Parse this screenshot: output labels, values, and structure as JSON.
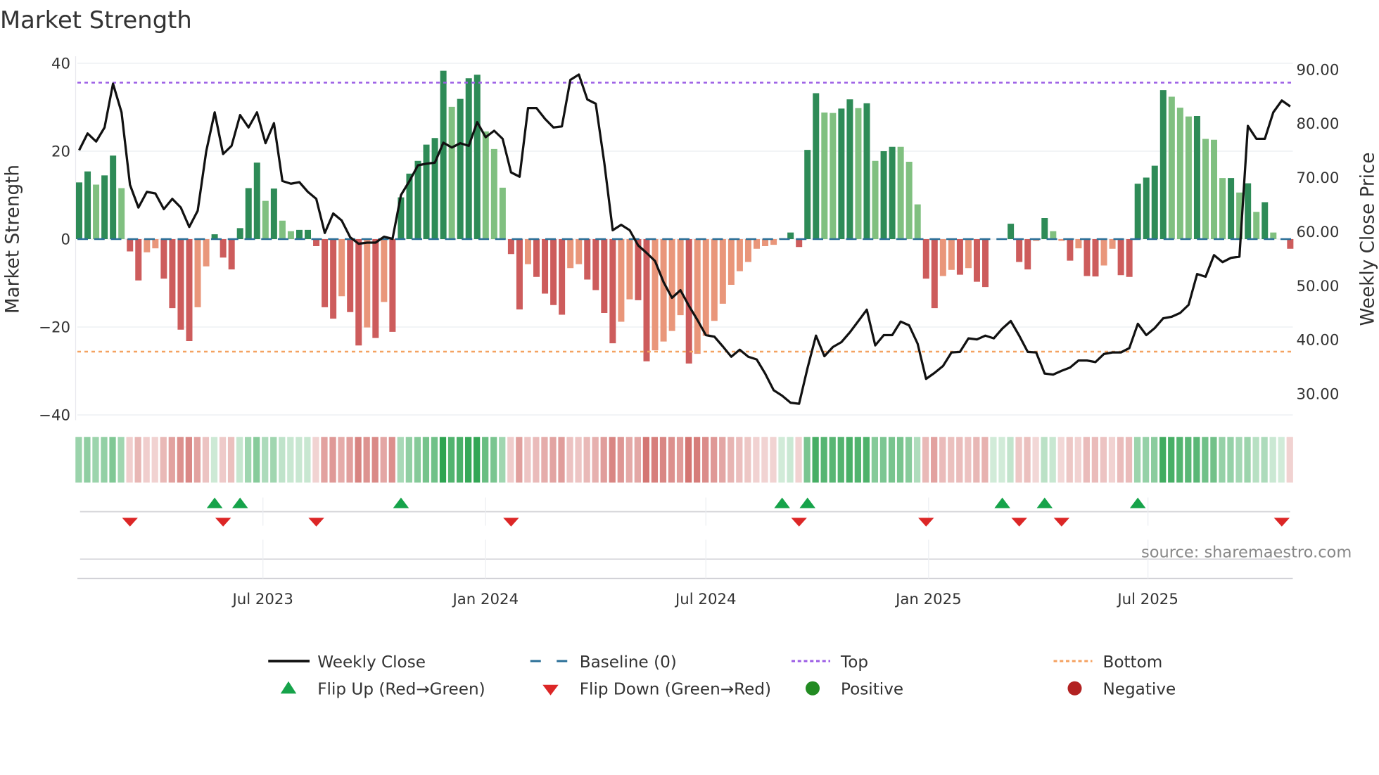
{
  "chart_data": {
    "type": "bar",
    "title": "Market Strength",
    "ylabel": "Market Strength",
    "y2label": "Weekly Close Price",
    "ylim": [
      -42,
      42
    ],
    "y2lim": [
      25,
      92
    ],
    "yticks": [
      40,
      20,
      0,
      -20,
      -40
    ],
    "ytick_labels": [
      "40",
      "20",
      "0",
      "−20",
      "−40"
    ],
    "y2ticks": [
      90,
      80,
      70,
      60,
      50,
      40,
      30
    ],
    "y2tick_labels": [
      "90.00",
      "80.00",
      "70.00",
      "60.00",
      "50.00",
      "40.00",
      "30.00"
    ],
    "x_unit": "week index",
    "xticks": [
      {
        "week": 22.7,
        "label": "Jul 2023"
      },
      {
        "week": 49,
        "label": "Jan 2024"
      },
      {
        "week": 75,
        "label": "Jul 2024"
      },
      {
        "week": 101.3,
        "label": "Jan 2025"
      },
      {
        "week": 127.2,
        "label": "Jul 2025"
      }
    ],
    "strength": [
      12.9,
      15.4,
      12.4,
      14.5,
      19,
      11.6,
      -2.8,
      -9.4,
      -3,
      -2.1,
      -9,
      -15.7,
      -20.6,
      -23.2,
      -15.5,
      -6.2,
      1.1,
      -4.2,
      -6.9,
      2.5,
      11.6,
      17.4,
      8.7,
      11.5,
      4.2,
      1.8,
      2.1,
      2.1,
      -1.6,
      -15.5,
      -18.1,
      -13,
      -16.6,
      -24.2,
      -20.1,
      -22.5,
      -14.3,
      -21.1,
      9.5,
      14.9,
      17.8,
      21.5,
      23,
      38.3,
      30.1,
      31.9,
      36.6,
      37.4,
      24.5,
      20.5,
      11.7,
      -3.4,
      -16,
      -5.7,
      -8.6,
      -12.4,
      -15,
      -17.2,
      -6.6,
      -5.7,
      -9.2,
      -11.6,
      -16.8,
      -23.7,
      -18.8,
      -13.7,
      -13.9,
      -27.8,
      -25.3,
      -23.3,
      -20.9,
      -17.3,
      -28.3,
      -26.1,
      -22,
      -18.6,
      -14.7,
      -10.4,
      -7.3,
      -5.2,
      -2.2,
      -1.6,
      -1.3,
      0.2,
      1.5,
      -1.8,
      20.3,
      33.2,
      28.8,
      28.7,
      29.7,
      31.8,
      29.8,
      30.9,
      17.8,
      20,
      21,
      21,
      17.6,
      7.9,
      -9,
      -15.7,
      -8.4,
      -7,
      -8.1,
      -6.6,
      -9.7,
      -10.9,
      0,
      0,
      3.5,
      -5.2,
      -6.9,
      -0.4,
      4.8,
      1.8,
      -0.4,
      -4.9,
      -2.1,
      -8.4,
      -8.5,
      -6,
      -2.2,
      -8.2,
      -8.6,
      12.6,
      14,
      16.7,
      33.9,
      32.4,
      29.9,
      27.9,
      28,
      22.8,
      22.6,
      13.9,
      13.9,
      10.6,
      12.7,
      6.2,
      8.4,
      1.5,
      0,
      -2.2
    ],
    "strong": [
      1,
      1,
      0,
      1,
      1,
      0,
      1,
      1,
      0,
      0,
      1,
      1,
      1,
      1,
      0,
      0,
      1,
      1,
      1,
      1,
      1,
      1,
      0,
      1,
      0,
      0,
      1,
      1,
      1,
      1,
      1,
      0,
      1,
      1,
      0,
      1,
      0,
      1,
      1,
      1,
      1,
      1,
      1,
      1,
      0,
      1,
      1,
      1,
      0,
      0,
      0,
      1,
      1,
      0,
      1,
      1,
      1,
      1,
      0,
      0,
      1,
      1,
      1,
      1,
      0,
      0,
      1,
      1,
      0,
      0,
      0,
      0,
      1,
      0,
      0,
      0,
      0,
      0,
      0,
      0,
      0,
      0,
      0,
      0,
      1,
      1,
      1,
      1,
      0,
      0,
      1,
      1,
      0,
      1,
      0,
      1,
      1,
      0,
      0,
      0,
      1,
      1,
      0,
      0,
      1,
      0,
      1,
      1,
      0,
      0,
      1,
      1,
      1,
      0,
      1,
      0,
      0,
      1,
      0,
      1,
      1,
      0,
      0,
      1,
      1,
      1,
      1,
      1,
      1,
      0,
      0,
      0,
      1,
      0,
      0,
      0,
      1,
      0,
      1,
      0,
      1,
      0,
      0,
      1
    ],
    "weekly_close": [
      74.9,
      78,
      76.5,
      79.1,
      87.2,
      81.9,
      68.5,
      64.3,
      67.2,
      66.9,
      64,
      65.9,
      64.3,
      60.7,
      63.7,
      74.7,
      81.9,
      74.2,
      75.7,
      81.4,
      79.1,
      81.9,
      76.2,
      79.9,
      69.2,
      68.7,
      69,
      67.2,
      65.9,
      59.6,
      63.2,
      61.9,
      58.8,
      57.6,
      57.8,
      57.8,
      58.9,
      58.5,
      66.6,
      69.2,
      72.1,
      72.4,
      72.6,
      76.3,
      75.4,
      76.2,
      75.7,
      80.1,
      77.3,
      78.5,
      77,
      70.8,
      70,
      82.7,
      82.7,
      80.7,
      79.1,
      79.3,
      87.9,
      88.9,
      84.3,
      83.5,
      72.6,
      60.1,
      61.1,
      60.1,
      57.3,
      55.9,
      54.4,
      50.5,
      47.6,
      49,
      46.1,
      43.5,
      40.7,
      40.4,
      38.6,
      36.7,
      38,
      36.7,
      36.2,
      33.6,
      30.5,
      29.5,
      28.2,
      28,
      34.6,
      40.6,
      36.8,
      38.5,
      39.4,
      41.2,
      43.3,
      45.4,
      38.8,
      40.7,
      40.7,
      43.2,
      42.5,
      39.1,
      32.6,
      33.7,
      35,
      37.5,
      37.6,
      40.1,
      39.9,
      40.6,
      40.1,
      41.9,
      43.3,
      40.6,
      37.6,
      37.5,
      33.6,
      33.4,
      34.1,
      34.7,
      36,
      36,
      35.7,
      37.2,
      37.5,
      37.5,
      38.3,
      42.8,
      40.7,
      42,
      43.8,
      44.1,
      44.8,
      46.3,
      52,
      51.5,
      55.5,
      54.2,
      55,
      55.2,
      79.4,
      77,
      77,
      81.9,
      84.1,
      83
    ],
    "top_level": 35.6,
    "bottom_level": -25.6,
    "baseline": 0,
    "flip_up_weeks": [
      17,
      20,
      39,
      84,
      87,
      110,
      115,
      126
    ],
    "flip_down_weeks": [
      7,
      18,
      29,
      52,
      86,
      101,
      112,
      117,
      143
    ],
    "legend_position": "bottom",
    "legend": [
      {
        "label": "Weekly Close",
        "kind": "line-solid",
        "color": "#111111"
      },
      {
        "label": "Baseline (0)",
        "kind": "line-dashed",
        "color": "#2a6f97"
      },
      {
        "label": "Top",
        "kind": "line-dotted",
        "color": "#9b5de5"
      },
      {
        "label": "Bottom",
        "kind": "line-dotted",
        "color": "#f4a261"
      },
      {
        "label": "Flip Up (Red→Green)",
        "kind": "triangle-up",
        "color": "#16a34a"
      },
      {
        "label": "Flip Down (Green→Red)",
        "kind": "triangle-down",
        "color": "#dc2626"
      },
      {
        "label": "Positive",
        "kind": "dot",
        "color": "#228b22"
      },
      {
        "label": "Negative",
        "kind": "dot",
        "color": "#b22222"
      }
    ],
    "colors": {
      "strong_pos": "#2e8b57",
      "weak_pos": "#80c080",
      "strong_neg": "#cd5c5c",
      "weak_neg": "#e9967a",
      "strip_pos": "#2ca34f",
      "strip_neg": "#c8504c"
    }
  },
  "source": "source: sharemaestro.com"
}
